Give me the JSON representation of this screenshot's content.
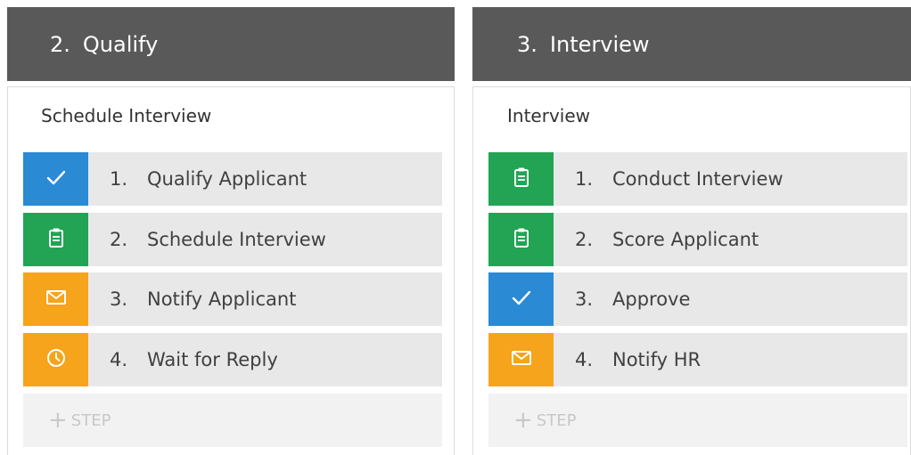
{
  "stages": [
    {
      "number": "2.",
      "name": "Qualify",
      "process_name": "Schedule Interview",
      "steps": [
        {
          "number": "1.",
          "label": "Qualify Applicant",
          "icon": "check-icon",
          "color": "#2a8ad4"
        },
        {
          "number": "2.",
          "label": "Schedule Interview",
          "icon": "clipboard-icon",
          "color": "#23a455"
        },
        {
          "number": "3.",
          "label": "Notify Applicant",
          "icon": "envelope-icon",
          "color": "#f5a41b"
        },
        {
          "number": "4.",
          "label": "Wait for Reply",
          "icon": "clock-icon",
          "color": "#f5a41b"
        }
      ],
      "add_step_label": "STEP"
    },
    {
      "number": "3.",
      "name": "Interview",
      "process_name": "Interview",
      "steps": [
        {
          "number": "1.",
          "label": "Conduct Interview",
          "icon": "clipboard-icon",
          "color": "#23a455"
        },
        {
          "number": "2.",
          "label": "Score Applicant",
          "icon": "clipboard-icon",
          "color": "#23a455"
        },
        {
          "number": "3.",
          "label": "Approve",
          "icon": "check-icon",
          "color": "#2a8ad4"
        },
        {
          "number": "4.",
          "label": "Notify HR",
          "icon": "envelope-icon",
          "color": "#f5a41b"
        }
      ],
      "add_step_label": "STEP"
    }
  ],
  "colors": {
    "header_bg": "#595959",
    "step_bg": "#e8e8e8",
    "add_step_bg": "#f2f2f2"
  }
}
